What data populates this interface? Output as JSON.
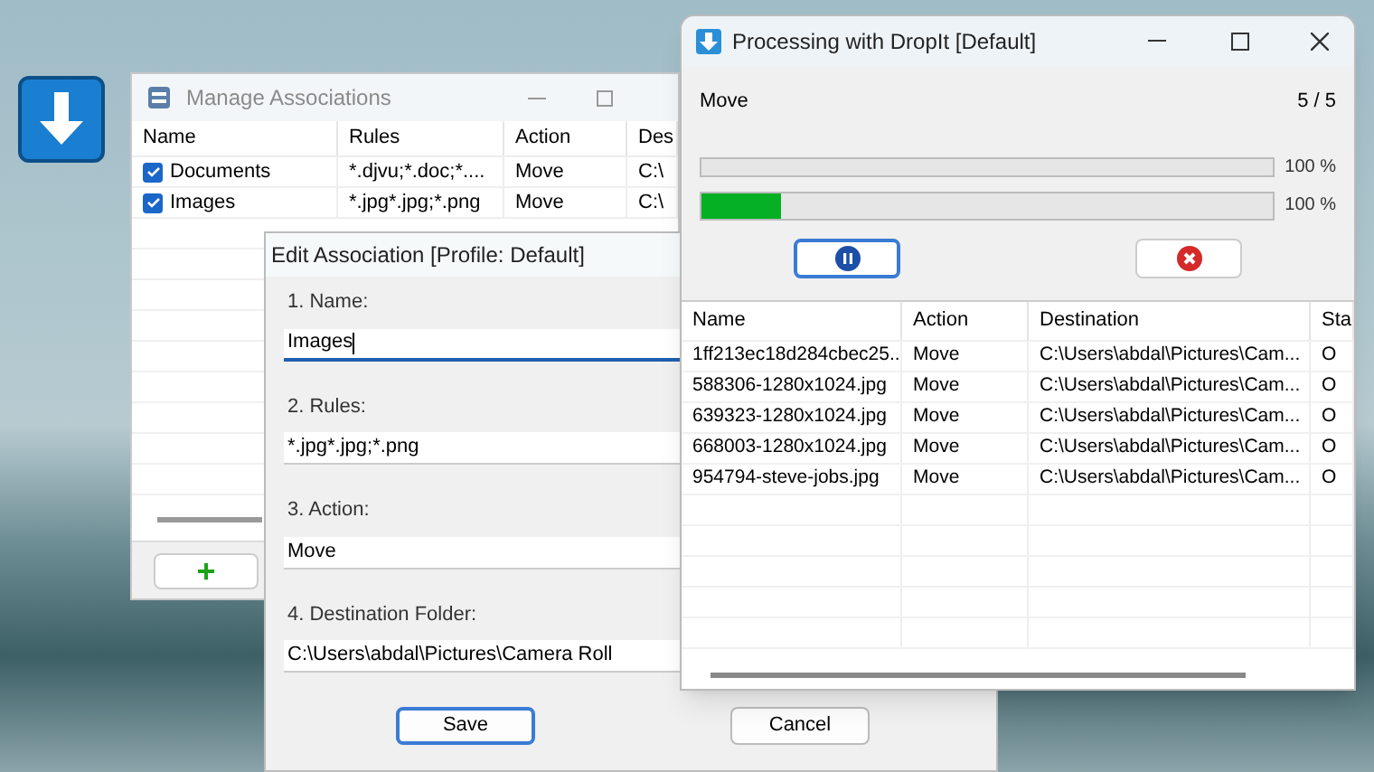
{
  "manage_window": {
    "title": "Manage Associations",
    "columns": [
      "Name",
      "Rules",
      "Action",
      "Des"
    ],
    "rows": [
      {
        "checked": true,
        "cells": [
          "Documents",
          "*.djvu;*.doc;*....",
          "Move",
          "C:\\"
        ]
      },
      {
        "checked": true,
        "cells": [
          "Images",
          "*.jpg*.jpg;*.png",
          "Move",
          "C:\\"
        ]
      }
    ],
    "add_button": "+"
  },
  "edit_dialog": {
    "title": "Edit Association [Profile: Default]",
    "fields": [
      {
        "label": "1. Name:",
        "value": "Images",
        "focused": true
      },
      {
        "label": "2. Rules:",
        "value": "*.jpg*.jpg;*.png",
        "focused": false
      },
      {
        "label": "3. Action:",
        "value": "Move",
        "focused": false
      },
      {
        "label": "4. Destination Folder:",
        "value": "C:\\Users\\abdal\\Pictures\\Camera Roll",
        "focused": false
      }
    ],
    "buttons": [
      "Save",
      "Cancel"
    ]
  },
  "processing_window": {
    "title": "Processing with DropIt [Default]",
    "action": "Move",
    "count": "5 / 5",
    "progress": [
      {
        "level": 1.0,
        "reading": "100 %",
        "shown": false
      },
      {
        "level": 0.14,
        "reading": "100 %",
        "shown": true
      }
    ],
    "columns": [
      "Name",
      "Action",
      "Destination",
      "Sta"
    ],
    "rows": [
      [
        "1ff213ec18d284cbec25...",
        "Move",
        "C:\\Users\\abdal\\Pictures\\Cam...",
        "O"
      ],
      [
        "588306-1280x1024.jpg",
        "Move",
        "C:\\Users\\abdal\\Pictures\\Cam...",
        "O"
      ],
      [
        "639323-1280x1024.jpg",
        "Move",
        "C:\\Users\\abdal\\Pictures\\Cam...",
        "O"
      ],
      [
        "668003-1280x1024.jpg",
        "Move",
        "C:\\Users\\abdal\\Pictures\\Cam...",
        "O"
      ],
      [
        "954794-steve-jobs.jpg",
        "Move",
        "C:\\Users\\abdal\\Pictures\\Cam...",
        "O"
      ]
    ]
  }
}
